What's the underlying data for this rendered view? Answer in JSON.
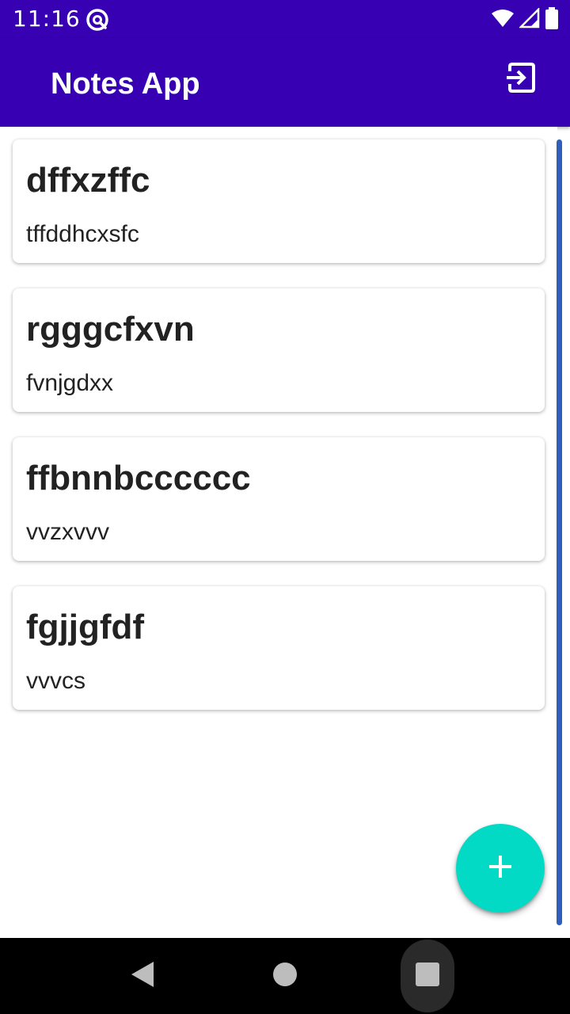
{
  "status_bar": {
    "time": "11:16",
    "app_icon": "at-sign-icon",
    "wifi_icon": "wifi-icon",
    "signal_icon": "signal-icon",
    "battery_icon": "battery-icon"
  },
  "app_bar": {
    "title": "Notes App",
    "logout_icon": "logout-icon"
  },
  "notes": [
    {
      "title": "dffxzffc",
      "body": "tffddhcxsfc"
    },
    {
      "title": "rgggcfxvn",
      "body": "fvnjgdxx"
    },
    {
      "title": "ffbnnbcccccc",
      "body": "vvzxvvv"
    },
    {
      "title": "fgjjgfdf",
      "body": "vvvcs"
    }
  ],
  "fab": {
    "icon": "plus-icon"
  },
  "navigation": {
    "back_icon": "back-triangle-icon",
    "home_icon": "home-circle-icon",
    "recents_icon": "recents-square-icon"
  },
  "colors": {
    "primary": "#3700b3",
    "accent": "#03dac5",
    "scrollbar": "#2f5fb8",
    "text": "#222222"
  }
}
